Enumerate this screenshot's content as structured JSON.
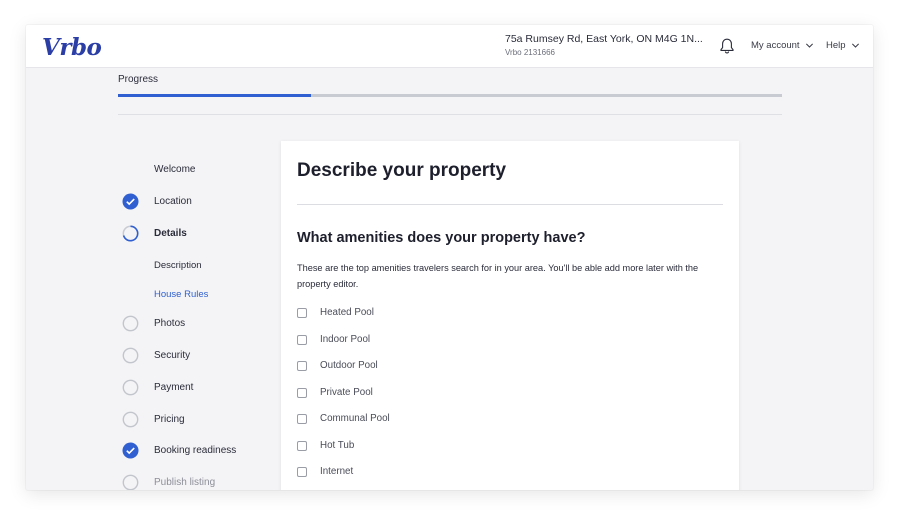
{
  "brand": {
    "logo_text": "Vrbo",
    "color": "#2b3ea6"
  },
  "header": {
    "address": "75a Rumsey Rd, East York, ON M4G 1N...",
    "listing_id": "Vrbo 2131666",
    "notifications_icon": "bell-icon",
    "my_account_label": "My account",
    "help_label": "Help"
  },
  "progress": {
    "label": "Progress",
    "fraction": 0.29,
    "accent": "#2f5fd0"
  },
  "steps": [
    {
      "label": "Welcome",
      "status": "none"
    },
    {
      "label": "Location",
      "status": "complete"
    },
    {
      "label": "Details",
      "status": "in-progress"
    },
    {
      "label": "Description",
      "status": "substep"
    },
    {
      "label": "House Rules",
      "status": "substep-active"
    },
    {
      "label": "Photos",
      "status": "pending"
    },
    {
      "label": "Security",
      "status": "pending"
    },
    {
      "label": "Payment",
      "status": "pending"
    },
    {
      "label": "Pricing",
      "status": "pending"
    },
    {
      "label": "Booking readiness",
      "status": "complete"
    },
    {
      "label": "Publish listing",
      "status": "pending"
    }
  ],
  "card": {
    "title": "Describe your property",
    "question": "What amenities does your property have?",
    "description": "These are the top amenities travelers search for in your area. You'll be able add more later with the property editor.",
    "amenities": [
      {
        "label": "Heated Pool",
        "checked": false
      },
      {
        "label": "Indoor Pool",
        "checked": false
      },
      {
        "label": "Outdoor Pool",
        "checked": false
      },
      {
        "label": "Private Pool",
        "checked": false
      },
      {
        "label": "Communal Pool",
        "checked": false
      },
      {
        "label": "Hot Tub",
        "checked": false
      },
      {
        "label": "Internet",
        "checked": false
      }
    ]
  }
}
